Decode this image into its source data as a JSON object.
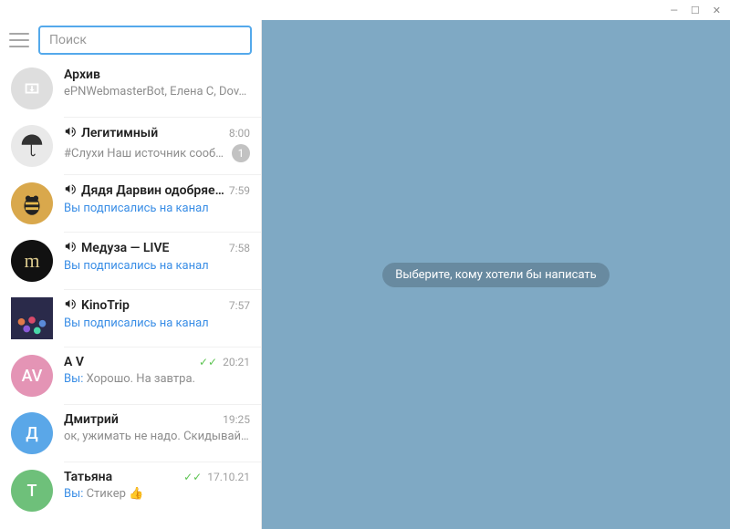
{
  "search": {
    "placeholder": "Поиск"
  },
  "main": {
    "placeholder": "Выберите, кому хотели бы написать"
  },
  "chats": [
    {
      "kind": "archive",
      "name": "Архив",
      "preview": "ePNWebmasterBot, Елена С, Dov…"
    },
    {
      "kind": "channel",
      "name": "Легитимный",
      "time": "8:00",
      "preview": "#Слухи  Наш источник сооб…",
      "unread": "1",
      "avatar_bg": "#e9e9e9",
      "avatar_extra": "umbrella"
    },
    {
      "kind": "channel",
      "name": "Дядя Дарвин одобряе…",
      "time": "7:59",
      "preview": "Вы подписались на канал",
      "preview_link": true,
      "avatar_bg": "#d9a84c",
      "avatar_extra": "bee"
    },
    {
      "kind": "channel",
      "name": "Медуза — LIVE",
      "time": "7:58",
      "preview": "Вы подписались на канал",
      "preview_link": true,
      "avatar_bg": "#111",
      "avatar_text": "m",
      "avatar_text_color": "#d8c78b"
    },
    {
      "kind": "channel",
      "name": "KinoTrip",
      "time": "7:57",
      "preview": "Вы подписались на канал",
      "preview_link": true,
      "avatar_bg": "#2a2a4a",
      "avatar_extra": "crowd"
    },
    {
      "kind": "dm",
      "name": "A V",
      "time": "20:21",
      "checks": true,
      "you_prefix": "Вы: ",
      "preview": "Хорошо. На завтра.",
      "avatar_bg": "#e494b5",
      "avatar_text": "AV"
    },
    {
      "kind": "dm",
      "name": "Дмитрий",
      "time": "19:25",
      "preview": "ок, ужимать не надо. Скидывай…",
      "avatar_bg": "#5aa7e8",
      "avatar_text": "Д"
    },
    {
      "kind": "dm",
      "name": "Татьяна",
      "time": "17.10.21",
      "checks": true,
      "you_prefix": "Вы: ",
      "preview": "Стикер 👍",
      "avatar_bg": "#6ec07a",
      "avatar_text": "Т"
    }
  ]
}
